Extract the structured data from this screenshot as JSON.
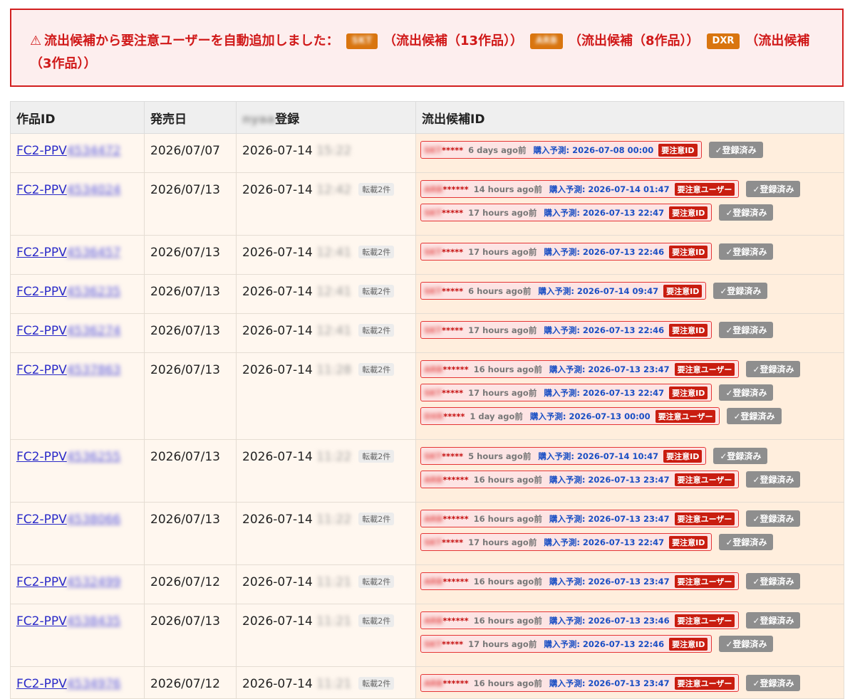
{
  "alert": {
    "icon": "warning-triangle-icon",
    "message": "流出候補から要注意ユーザーを自動追加しました：",
    "entries": [
      {
        "tag": "SKT",
        "tag_blurred": true,
        "text": "（流出候補（13作品））"
      },
      {
        "tag": "ARB",
        "tag_blurred": true,
        "text": "（流出候補（8作品））"
      },
      {
        "tag": "DXR",
        "tag_blurred": false,
        "text": "（流出候補（3作品））"
      }
    ]
  },
  "table": {
    "headers": {
      "work_id": "作品ID",
      "release": "発売日",
      "registered": "登録",
      "candidates": "流出候補ID"
    },
    "registered_prefix_blurred": "nyaa",
    "rows": [
      {
        "prefix": "FC2-PPV",
        "num": "4534472",
        "release": "2026/07/07",
        "reg_date": "2026-07-14",
        "reg_time": "15:22",
        "tenkai": "",
        "cands": [
          {
            "id_prefix": "SKT",
            "id_suffix": "*****",
            "ago": "6 days ago前",
            "pred": "購入予測: 2026-07-08 00:00",
            "flag": "要注意ID",
            "btn": "✓登録済み"
          }
        ]
      },
      {
        "prefix": "FC2-PPV",
        "num": "4534024",
        "release": "2026/07/13",
        "reg_date": "2026-07-14",
        "reg_time": "12:42",
        "tenkai": "転載2件",
        "cands": [
          {
            "id_prefix": "ARB",
            "id_suffix": "******",
            "ago": "14 hours ago前",
            "pred": "購入予測: 2026-07-14 01:47",
            "flag": "要注意ユーザー",
            "btn": "✓登録済み"
          },
          {
            "id_prefix": "SKT",
            "id_suffix": "*****",
            "ago": "17 hours ago前",
            "pred": "購入予測: 2026-07-13 22:47",
            "flag": "要注意ID",
            "btn": "✓登録済み"
          }
        ]
      },
      {
        "prefix": "FC2-PPV",
        "num": "4536457",
        "release": "2026/07/13",
        "reg_date": "2026-07-14",
        "reg_time": "12:41",
        "tenkai": "転載2件",
        "cands": [
          {
            "id_prefix": "SKT",
            "id_suffix": "*****",
            "ago": "17 hours ago前",
            "pred": "購入予測: 2026-07-13 22:46",
            "flag": "要注意ID",
            "btn": "✓登録済み"
          }
        ]
      },
      {
        "prefix": "FC2-PPV",
        "num": "4536235",
        "release": "2026/07/13",
        "reg_date": "2026-07-14",
        "reg_time": "12:41",
        "tenkai": "転載2件",
        "cands": [
          {
            "id_prefix": "SKT",
            "id_suffix": "*****",
            "ago": "6 hours ago前",
            "pred": "購入予測: 2026-07-14 09:47",
            "flag": "要注意ID",
            "btn": "✓登録済み"
          }
        ]
      },
      {
        "prefix": "FC2-PPV",
        "num": "4536274",
        "release": "2026/07/13",
        "reg_date": "2026-07-14",
        "reg_time": "12:41",
        "tenkai": "転載2件",
        "cands": [
          {
            "id_prefix": "SKT",
            "id_suffix": "*****",
            "ago": "17 hours ago前",
            "pred": "購入予測: 2026-07-13 22:46",
            "flag": "要注意ID",
            "btn": "✓登録済み"
          }
        ]
      },
      {
        "prefix": "FC2-PPV",
        "num": "4537863",
        "release": "2026/07/13",
        "reg_date": "2026-07-14",
        "reg_time": "11:28",
        "tenkai": "転載2件",
        "cands": [
          {
            "id_prefix": "ARB",
            "id_suffix": "******",
            "ago": "16 hours ago前",
            "pred": "購入予測: 2026-07-13 23:47",
            "flag": "要注意ユーザー",
            "btn": "✓登録済み"
          },
          {
            "id_prefix": "SKT",
            "id_suffix": "*****",
            "ago": "17 hours ago前",
            "pred": "購入予測: 2026-07-13 22:47",
            "flag": "要注意ID",
            "btn": "✓登録済み"
          },
          {
            "id_prefix": "DXR",
            "id_suffix": "*****",
            "ago": "1 day ago前",
            "pred": "購入予測: 2026-07-13 00:00",
            "flag": "要注意ユーザー",
            "btn": "✓登録済み"
          }
        ]
      },
      {
        "prefix": "FC2-PPV",
        "num": "4536255",
        "release": "2026/07/13",
        "reg_date": "2026-07-14",
        "reg_time": "11:22",
        "tenkai": "転載2件",
        "cands": [
          {
            "id_prefix": "SKT",
            "id_suffix": "*****",
            "ago": "5 hours ago前",
            "pred": "購入予測: 2026-07-14 10:47",
            "flag": "要注意ID",
            "btn": "✓登録済み"
          },
          {
            "id_prefix": "ARB",
            "id_suffix": "******",
            "ago": "16 hours ago前",
            "pred": "購入予測: 2026-07-13 23:47",
            "flag": "要注意ユーザー",
            "btn": "✓登録済み"
          }
        ]
      },
      {
        "prefix": "FC2-PPV",
        "num": "4538066",
        "release": "2026/07/13",
        "reg_date": "2026-07-14",
        "reg_time": "11:22",
        "tenkai": "転載2件",
        "cands": [
          {
            "id_prefix": "ARB",
            "id_suffix": "******",
            "ago": "16 hours ago前",
            "pred": "購入予測: 2026-07-13 23:47",
            "flag": "要注意ユーザー",
            "btn": "✓登録済み"
          },
          {
            "id_prefix": "SKT",
            "id_suffix": "*****",
            "ago": "17 hours ago前",
            "pred": "購入予測: 2026-07-13 22:47",
            "flag": "要注意ID",
            "btn": "✓登録済み"
          }
        ]
      },
      {
        "prefix": "FC2-PPV",
        "num": "4532499",
        "release": "2026/07/12",
        "reg_date": "2026-07-14",
        "reg_time": "11:21",
        "tenkai": "転載2件",
        "cands": [
          {
            "id_prefix": "ARB",
            "id_suffix": "******",
            "ago": "16 hours ago前",
            "pred": "購入予測: 2026-07-13 23:47",
            "flag": "要注意ユーザー",
            "btn": "✓登録済み"
          }
        ]
      },
      {
        "prefix": "FC2-PPV",
        "num": "4538435",
        "release": "2026/07/13",
        "reg_date": "2026-07-14",
        "reg_time": "11:21",
        "tenkai": "転載2件",
        "cands": [
          {
            "id_prefix": "ARB",
            "id_suffix": "******",
            "ago": "16 hours ago前",
            "pred": "購入予測: 2026-07-13 23:46",
            "flag": "要注意ユーザー",
            "btn": "✓登録済み"
          },
          {
            "id_prefix": "SKT",
            "id_suffix": "*****",
            "ago": "17 hours ago前",
            "pred": "購入予測: 2026-07-13 22:46",
            "flag": "要注意ID",
            "btn": "✓登録済み"
          }
        ]
      },
      {
        "prefix": "FC2-PPV",
        "num": "4534976",
        "release": "2026/07/12",
        "reg_date": "2026-07-14",
        "reg_time": "11:21",
        "tenkai": "転載2件",
        "cands": [
          {
            "id_prefix": "ARB",
            "id_suffix": "******",
            "ago": "16 hours ago前",
            "pred": "購入予測: 2026-07-13 23:47",
            "flag": "要注意ユーザー",
            "btn": "✓登録済み"
          }
        ]
      }
    ]
  }
}
